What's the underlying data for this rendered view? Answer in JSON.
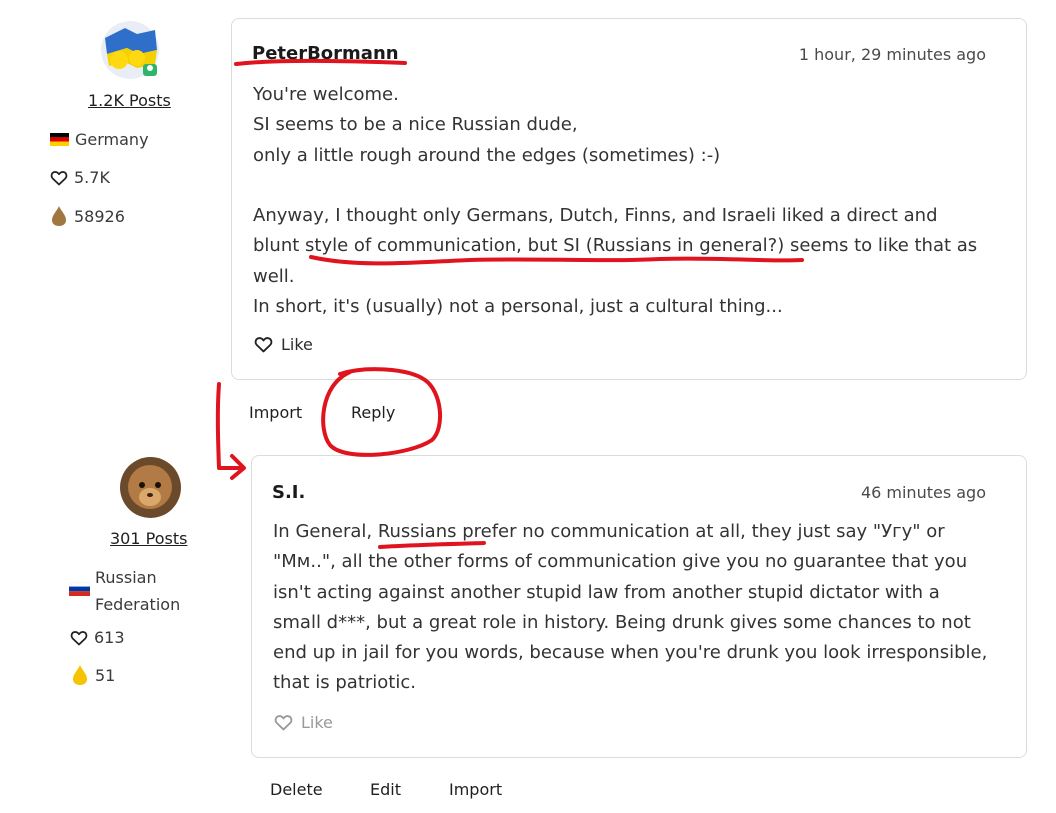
{
  "post1": {
    "author": {
      "posts_label": "1.2K Posts",
      "country": "Germany",
      "likes": "5.7K",
      "points": "58926",
      "flag_colors": [
        "#000000",
        "#dd0000",
        "#ffce00"
      ],
      "points_color": "#a0773e"
    },
    "username": "PeterBormann",
    "timestamp": "1 hour, 29 minutes ago",
    "lines": [
      "You're welcome.",
      "SI seems to be a nice Russian dude,",
      "only a little rough around the edges (sometimes) :-)",
      "",
      "Anyway, I thought only Germans, Dutch, Finns, and Israeli liked a direct and",
      "blunt style of communication, but SI (Russians in general?) seems to like that as",
      "well.",
      "In short, it's (usually) not a personal, just a cultural thing..."
    ],
    "like_label": "Like",
    "actions": [
      "Import",
      "Reply"
    ]
  },
  "post2": {
    "author": {
      "posts_label": "301 Posts",
      "country_line1": "Russian",
      "country_line2": "Federation",
      "likes": "613",
      "points": "51",
      "flag_colors": [
        "#ffffff",
        "#0039a6",
        "#d52b1e"
      ],
      "points_color": "#f5c400"
    },
    "username": "S.I.",
    "timestamp": "46 minutes ago",
    "lines": [
      "In General, Russians prefer no communication at all, they just say \"Угу\" or",
      "\"Мм..\", all the other forms of communication give you no guarantee that you",
      "isn't acting against another stupid law from another stupid dictator with a",
      "small d***, but a great role in history. Being drunk gives some chances to not",
      "end up in jail for you words, because when you're drunk you look irresponsible,",
      "that is patriotic."
    ],
    "like_label": "Like",
    "actions": [
      "Delete",
      "Edit",
      "Import"
    ]
  },
  "annotation_color": "#e0141e"
}
